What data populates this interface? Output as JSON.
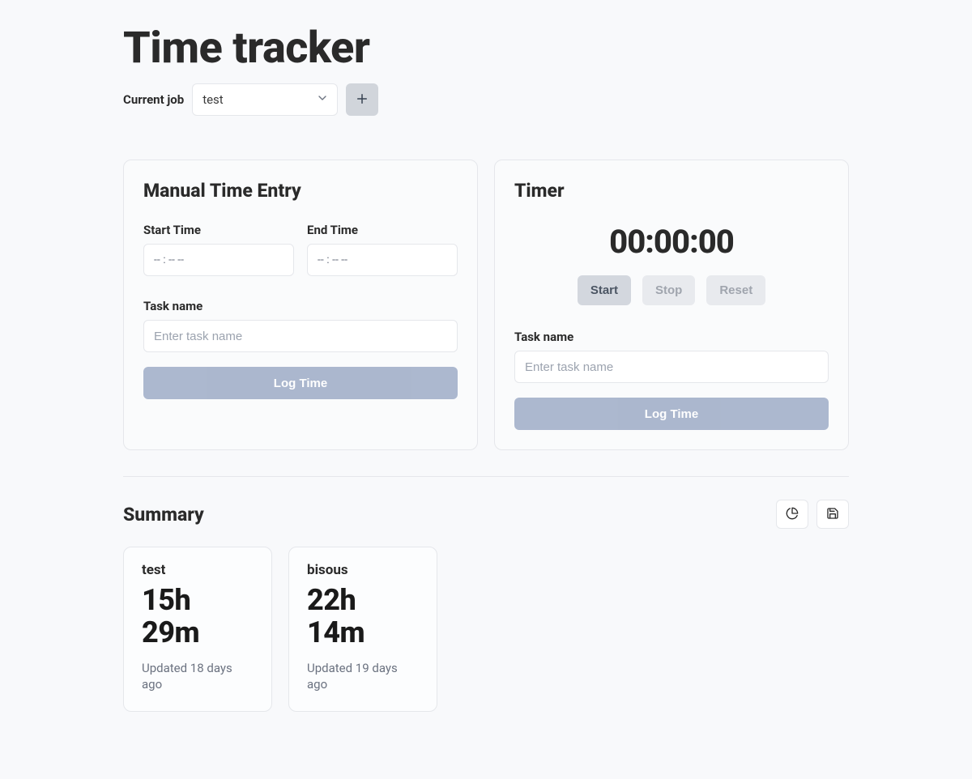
{
  "pageTitle": "Time tracker",
  "currentJob": {
    "label": "Current job",
    "selected": "test"
  },
  "manualEntry": {
    "title": "Manual Time Entry",
    "startLabel": "Start Time",
    "endLabel": "End Time",
    "timePlaceholder": "-- : --  --",
    "taskLabel": "Task name",
    "taskPlaceholder": "Enter task name",
    "logButton": "Log Time"
  },
  "timer": {
    "title": "Timer",
    "display": "00:00:00",
    "startButton": "Start",
    "stopButton": "Stop",
    "resetButton": "Reset",
    "taskLabel": "Task name",
    "taskPlaceholder": "Enter task name",
    "logButton": "Log Time"
  },
  "summary": {
    "title": "Summary",
    "cards": [
      {
        "name": "test",
        "time": "15h 29m",
        "updated": "Updated 18 days ago"
      },
      {
        "name": "bisous",
        "time": "22h 14m",
        "updated": "Updated 19 days ago"
      }
    ]
  }
}
